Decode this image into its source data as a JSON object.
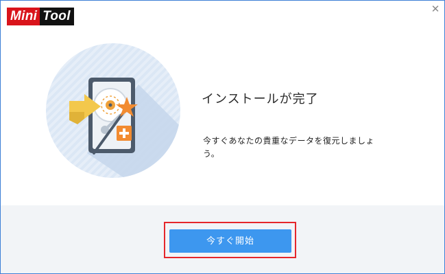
{
  "window": {
    "logo_text_left": "Mini",
    "logo_text_right": "Tool",
    "close_glyph": "✕"
  },
  "main": {
    "heading": "インストールが完了",
    "message": "今すぐあなたの貴重なデータを復元しましょう。",
    "illustration_icon": "hard-drive-restore-icon"
  },
  "footer": {
    "start_button_label": "今すぐ開始"
  },
  "colors": {
    "logo_red": "#d9141b",
    "logo_black": "#111111",
    "button_blue": "#3d97ef",
    "highlight_red": "#e5262b",
    "footer_bg": "#f2f4f7",
    "circle_blue": "#dbe7f5"
  }
}
